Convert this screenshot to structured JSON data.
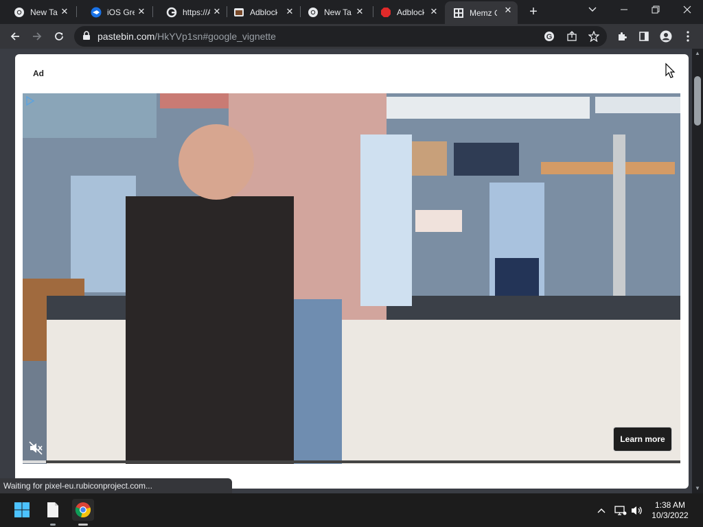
{
  "browser": {
    "tabs": [
      {
        "title": "New Tab",
        "favicon": "chrome-icon"
      },
      {
        "title": "iOS Green",
        "favicon": "ios-green-icon"
      },
      {
        "title": "https://A",
        "favicon": "google-icon"
      },
      {
        "title": "Adblock",
        "favicon": "adblock-icon"
      },
      {
        "title": "New Tab",
        "favicon": "chrome-icon"
      },
      {
        "title": "Adblock",
        "favicon": "adblock-red-icon"
      },
      {
        "title": "Memz C",
        "favicon": "pastebin-icon",
        "active": true
      }
    ],
    "url_host": "pastebin.com",
    "url_path": "/HkYVp1sn#google_vignette"
  },
  "ad": {
    "label": "Ad",
    "cta_label": "Learn more",
    "progress": 0.035
  },
  "status_text": "Waiting for pixel-eu.rubiconproject.com...",
  "taskbar": {
    "time": "1:38 AM",
    "date": "10/3/2022"
  },
  "colors": {
    "tabstrip": "#202124",
    "toolbar": "#35363a",
    "taskbar": "#1c1c1c",
    "cta_bg": "#1e1e1e"
  }
}
